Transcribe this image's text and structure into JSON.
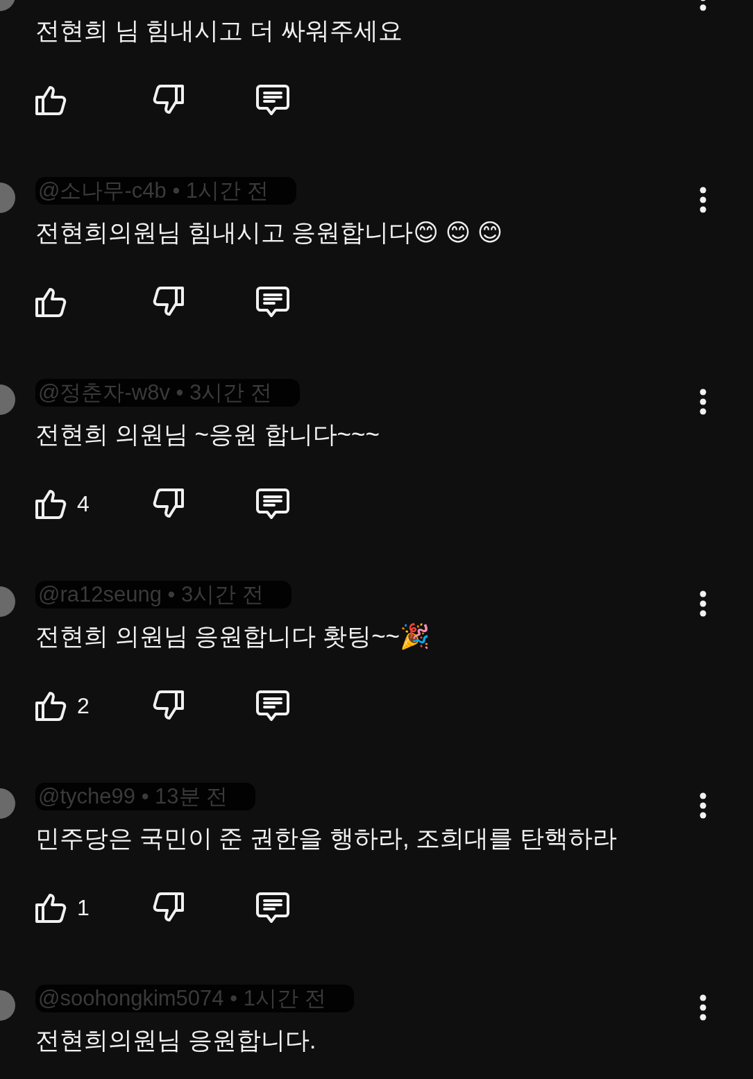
{
  "comments": [
    {
      "body": "전현희 님 힘내시고 더 싸워주세요",
      "actions": true
    },
    {
      "author": "@소나무-c4b • 1시간 전",
      "body": "전현희의원님 힘내시고 응원합니다😊 😊 😊",
      "actions": true
    },
    {
      "author": "@정춘자-w8v • 3시간 전",
      "body": "전현희 의원님 ~응원 합니다~~~",
      "actions": true,
      "likes": "4"
    },
    {
      "author": "@ra12seung • 3시간 전",
      "body": "전현희  의원님 응원합니다 홧팅~~🎉",
      "actions": true,
      "likes": "2"
    },
    {
      "author": "@tyche99 • 13분 전",
      "body": "민주당은 국민이 준 권한을 행하라, 조희대를 탄핵하라",
      "actions": true,
      "likes": "1"
    },
    {
      "author": "@soohongkim5074 • 1시간 전",
      "body": "전현희의원님 응원합니다.",
      "actions": false
    }
  ]
}
